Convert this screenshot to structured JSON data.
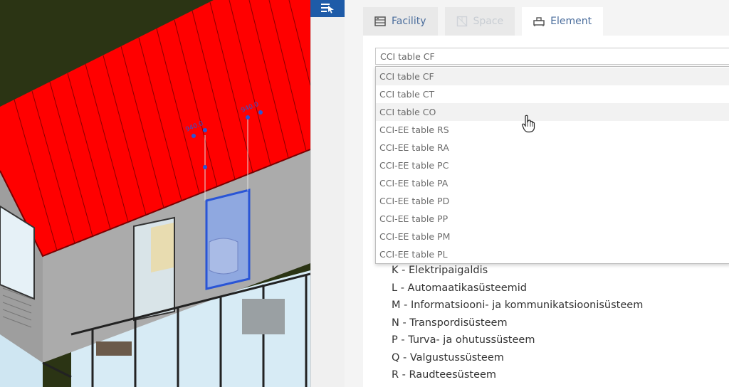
{
  "tabs": [
    {
      "label": "Facility",
      "icon": "facility-icon",
      "state": "normal"
    },
    {
      "label": "Space",
      "icon": "space-icon",
      "state": "disabled"
    },
    {
      "label": "Element",
      "icon": "element-icon",
      "state": "active"
    }
  ],
  "select": {
    "value": "CCI table CF"
  },
  "dropdown": {
    "options": [
      "CCI table CF",
      "CCI table CT",
      "CCI table CO",
      "CCI-EE table RS",
      "CCI-EE table RA",
      "CCI-EE table PC",
      "CCI-EE table PA",
      "CCI-EE table PD",
      "CCI-EE table PP",
      "CCI-EE table PM",
      "CCI-EE table PL"
    ],
    "selected_index": 0,
    "hovered_index": 2
  },
  "list": {
    "items": [
      "K - Elektripaigaldis",
      "L - Automaatikasüsteemid",
      "M - Informatsiooni- ja kommunikatsioonisüsteem",
      "N - Transpordisüsteem",
      "P - Turva- ja ohutussüsteem",
      "Q - Valgustussüsteem",
      "R - Raudteesüsteem"
    ]
  },
  "viewport": {
    "dimension_labels": [
      "940.0",
      "940.0"
    ],
    "roof_color": "#ff0000",
    "wall_color": "#a9a9a9"
  },
  "colors": {
    "accent": "#1e5ba8",
    "tab_text": "#4a6d9c"
  }
}
